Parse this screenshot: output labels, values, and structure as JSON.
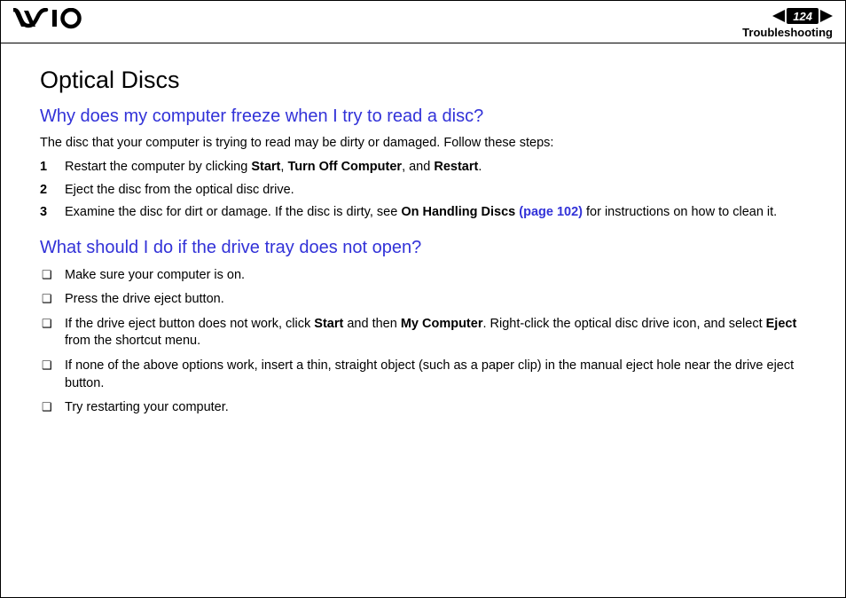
{
  "header": {
    "page_number": "124",
    "section": "Troubleshooting"
  },
  "title": "Optical Discs",
  "q1": {
    "heading": "Why does my computer freeze when I try to read a disc?",
    "intro": "The disc that your computer is trying to read may be dirty or damaged. Follow these steps:",
    "steps": [
      {
        "n": "1",
        "pre": "Restart the computer by clicking ",
        "b1": "Start",
        "mid1": ", ",
        "b2": "Turn Off Computer",
        "mid2": ", and ",
        "b3": "Restart",
        "post": "."
      },
      {
        "n": "2",
        "text": "Eject the disc from the optical disc drive."
      },
      {
        "n": "3",
        "pre": "Examine the disc for dirt or damage. If the disc is dirty, see ",
        "b1": "On Handling Discs",
        "link": " (page 102)",
        "post": " for instructions on how to clean it."
      }
    ]
  },
  "q2": {
    "heading": "What should I do if the drive tray does not open?",
    "items": [
      {
        "text": "Make sure your computer is on."
      },
      {
        "text": "Press the drive eject button."
      },
      {
        "pre": "If the drive eject button does not work, click ",
        "b1": "Start",
        "mid1": " and then ",
        "b2": "My Computer",
        "mid2": ". Right-click the optical disc drive icon, and select ",
        "b3": "Eject",
        "post": " from the shortcut menu."
      },
      {
        "text": "If none of the above options work, insert a thin, straight object (such as a paper clip) in the manual eject hole near the drive eject button."
      },
      {
        "text": "Try restarting your computer."
      }
    ]
  }
}
